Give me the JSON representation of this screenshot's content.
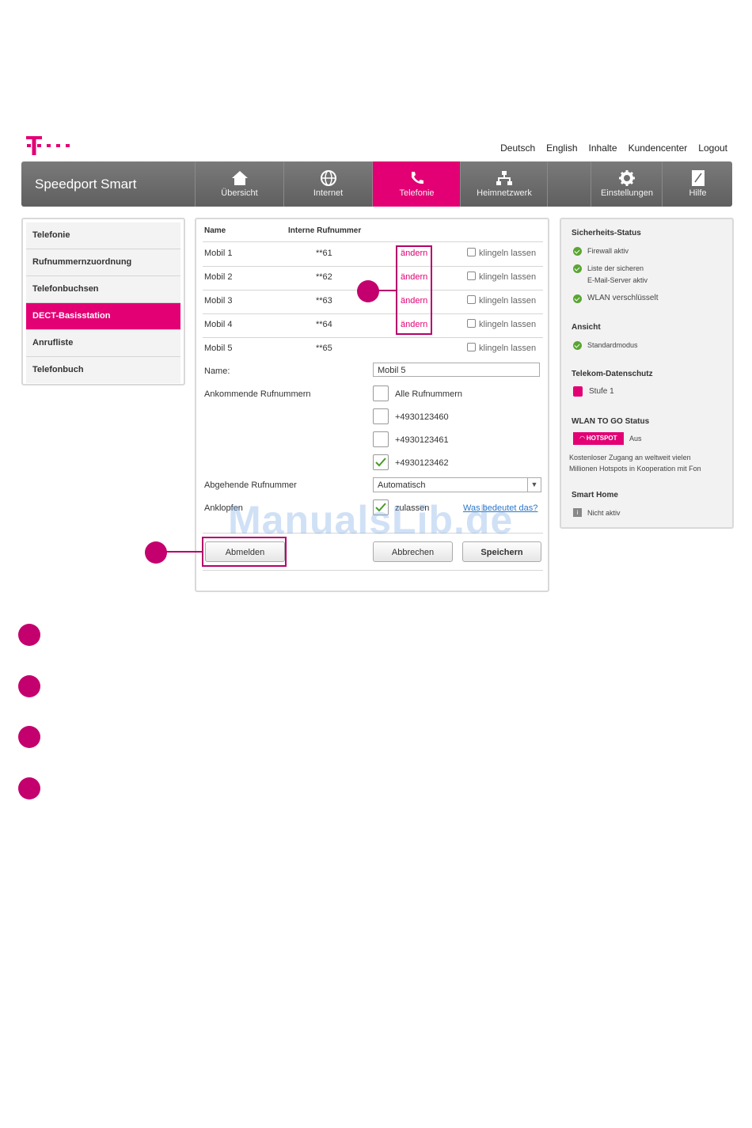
{
  "header": {
    "links": [
      "Deutsch",
      "English",
      "Inhalte",
      "Kundencenter",
      "Logout"
    ],
    "brand": "Speedport Smart",
    "nav": [
      {
        "label": "Übersicht",
        "icon": "home-icon"
      },
      {
        "label": "Internet",
        "icon": "globe-icon"
      },
      {
        "label": "Telefonie",
        "icon": "phone-icon",
        "active": true
      },
      {
        "label": "Heimnetzwerk",
        "icon": "network-icon"
      },
      {
        "label": "",
        "icon": ""
      },
      {
        "label": "Einstellungen",
        "icon": "gear-icon"
      },
      {
        "label": "Hilfe",
        "icon": "help-icon"
      }
    ]
  },
  "sidebar": {
    "items": [
      "Telefonie",
      "Rufnummernzuordnung",
      "Telefonbuchsen",
      "DECT-Basisstation",
      "Anrufliste",
      "Telefonbuch"
    ],
    "active_index": 3
  },
  "main": {
    "col_name": "Name",
    "col_number": "Interne Rufnummer",
    "rows": [
      {
        "name": "Mobil 1",
        "number": "**61",
        "action": "ändern",
        "ring": "klingeln lassen"
      },
      {
        "name": "Mobil 2",
        "number": "**62",
        "action": "ändern",
        "ring": "klingeln lassen"
      },
      {
        "name": "Mobil 3",
        "number": "**63",
        "action": "ändern",
        "ring": "klingeln lassen"
      },
      {
        "name": "Mobil 4",
        "number": "**64",
        "action": "ändern",
        "ring": "klingeln lassen"
      },
      {
        "name": "Mobil 5",
        "number": "**65",
        "action": "",
        "ring": "klingeln lassen"
      }
    ],
    "name_label": "Name:",
    "name_value": "Mobil 5",
    "incoming_label": "Ankommende Rufnummern",
    "incoming": [
      {
        "label": "Alle Rufnummern",
        "checked": false
      },
      {
        "label": "+4930123460",
        "checked": false
      },
      {
        "label": "+4930123461",
        "checked": false
      },
      {
        "label": "+4930123462",
        "checked": true
      }
    ],
    "outgoing_label": "Abgehende Rufnummer",
    "outgoing_value": "Automatisch",
    "knock_label": "Anklopfen",
    "knock_option": "zulassen",
    "knock_checked": true,
    "help_link": "Was bedeutet das?",
    "btn_logout": "Abmelden",
    "btn_cancel": "Abbrechen",
    "btn_save": "Speichern"
  },
  "status": {
    "security_title": "Sicherheits-Status",
    "firewall": "Firewall aktiv",
    "mailserver_line1": "Liste der sicheren",
    "mailserver_line2": "E-Mail-Server aktiv",
    "wlan": "WLAN verschlüsselt",
    "view_title": "Ansicht",
    "view_mode": "Standardmodus",
    "privacy_title": "Telekom-Datenschutz",
    "privacy_level": "Stufe 1",
    "wlantogo_title": "WLAN TO GO Status",
    "hotspot_badge": "HOTSPOT",
    "hotspot_state": "Aus",
    "hotspot_desc_line1": "Kostenloser Zugang an weltweit vielen",
    "hotspot_desc_line2": "Millionen Hotspots in Kooperation mit Fon",
    "smarthome_title": "Smart Home",
    "smarthome_state": "Nicht aktiv"
  },
  "watermark": "ManualsLib.de",
  "colors": {
    "magenta": "#e20074",
    "callout": "#c4006e",
    "ok_green": "#5aa532"
  }
}
